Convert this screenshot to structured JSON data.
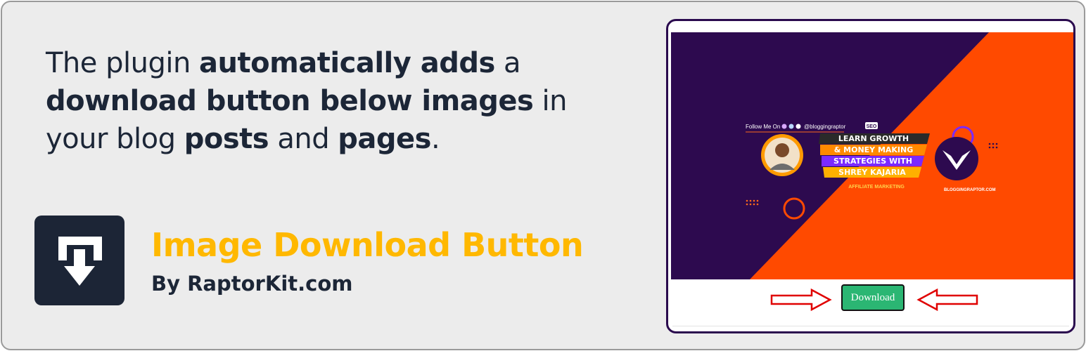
{
  "headline": {
    "p1": "The plugin ",
    "b1": "automatically adds",
    "p2": " a ",
    "b2": "download button below images",
    "p3": " in your blog ",
    "b3": "posts",
    "p4": " and ",
    "b4": "pages",
    "p5": "."
  },
  "plugin": {
    "name": "Image Download Button",
    "author": "By RaptorKit.com"
  },
  "preview": {
    "follow_text": "Follow Me On",
    "handle": "@bloggingraptor",
    "seo_tag": "SEO",
    "line1": "LEARN GROWTH",
    "line2": "& MONEY MAKING",
    "line3": "STRATEGIES WITH",
    "line4": "SHREY KAJARIA",
    "affiliate_tag": "AFFILIATE MARKETING",
    "site": "BLOGGINGRAPTOR.COM",
    "download_label": "Download"
  },
  "colors": {
    "headline_text": "#1c2637",
    "plugin_name": "#ffb800",
    "logo_bg": "#1c2536",
    "purple": "#2d0a4f",
    "orange": "#ff4a00",
    "button_green": "#2bb673",
    "arrow_red": "#e00000"
  },
  "icons": [
    "download-arrow-icon",
    "right-arrow-icon",
    "left-arrow-icon",
    "brand-emblem-icon"
  ]
}
